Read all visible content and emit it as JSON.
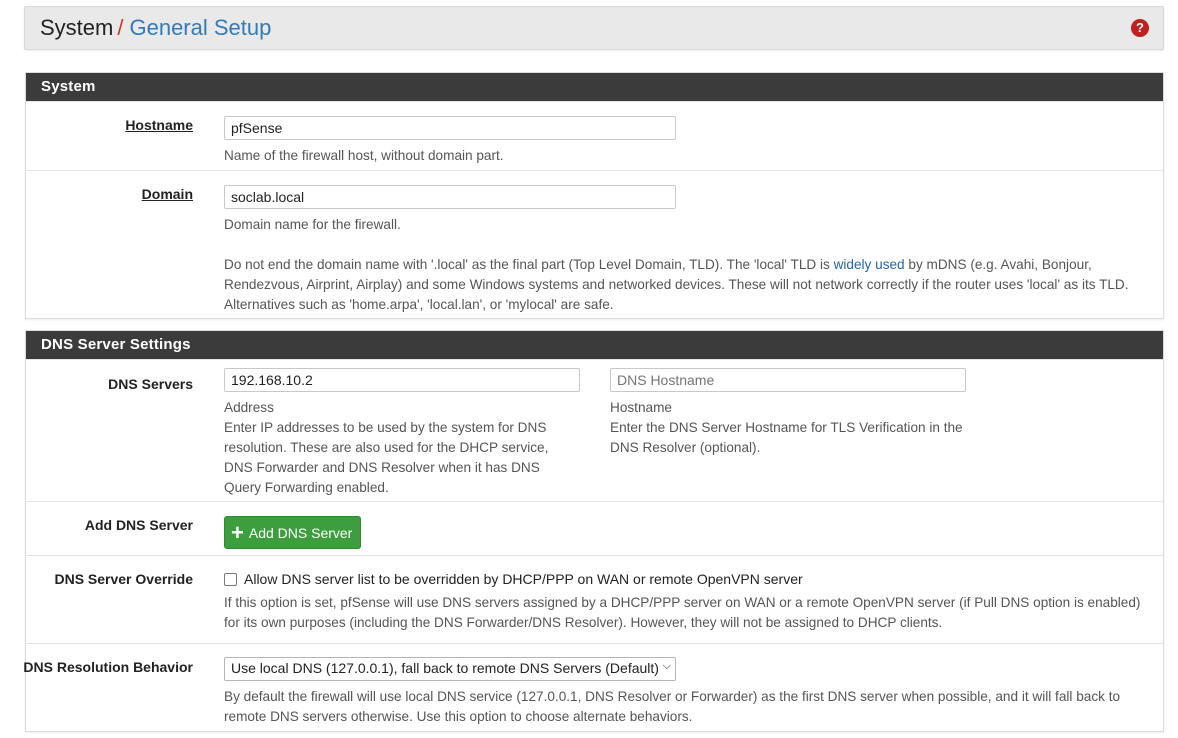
{
  "breadcrumb": {
    "root": "System",
    "separator": "/",
    "current": "General Setup"
  },
  "help_icon": "?",
  "system_panel": {
    "title": "System",
    "hostname": {
      "label": "Hostname",
      "value": "pfSense",
      "help": "Name of the firewall host, without domain part."
    },
    "domain": {
      "label": "Domain",
      "value": "soclab.local",
      "help": "Domain name for the firewall.",
      "note_before_link": "Do not end the domain name with '.local' as the final part (Top Level Domain, TLD). The 'local' TLD is ",
      "note_link": "widely used",
      "note_after_link": " by mDNS (e.g. Avahi, Bonjour, Rendezvous, Airprint, Airplay) and some Windows systems and networked devices. These will not network correctly if the router uses 'local' as its TLD. Alternatives such as 'home.arpa', 'local.lan', or 'mylocal' are safe."
    }
  },
  "dns_panel": {
    "title": "DNS Server Settings",
    "dns_servers": {
      "label": "DNS Servers",
      "address_value": "192.168.10.2",
      "address_caption": "Address",
      "address_help": "Enter IP addresses to be used by the system for DNS resolution. These are also used for the DHCP service, DNS Forwarder and DNS Resolver when it has DNS Query Forwarding enabled.",
      "hostname_placeholder": "DNS Hostname",
      "hostname_caption": "Hostname",
      "hostname_help": "Enter the DNS Server Hostname for TLS Verification in the DNS Resolver (optional)."
    },
    "add_dns": {
      "label": "Add DNS Server",
      "button": "Add DNS Server"
    },
    "override": {
      "label": "DNS Server Override",
      "checkbox_label": "Allow DNS server list to be overridden by DHCP/PPP on WAN or remote OpenVPN server",
      "checked": false,
      "help": "If this option is set, pfSense will use DNS servers assigned by a DHCP/PPP server on WAN or a remote OpenVPN server (if Pull DNS option is enabled) for its own purposes (including the DNS Forwarder/DNS Resolver). However, they will not be assigned to DHCP clients."
    },
    "resolution": {
      "label": "DNS Resolution Behavior",
      "selected": "Use local DNS (127.0.0.1), fall back to remote DNS Servers (Default)",
      "help": "By default the firewall will use local DNS service (127.0.0.1, DNS Resolver or Forwarder) as the first DNS server when possible, and it will fall back to remote DNS servers otherwise. Use this option to choose alternate behaviors."
    }
  },
  "colors": {
    "heading_bg": "#3b3b3b",
    "link": "#337ab7",
    "separator": "#c0392b",
    "button_green": "#3c9e3c",
    "help_icon": "#c0201e"
  }
}
